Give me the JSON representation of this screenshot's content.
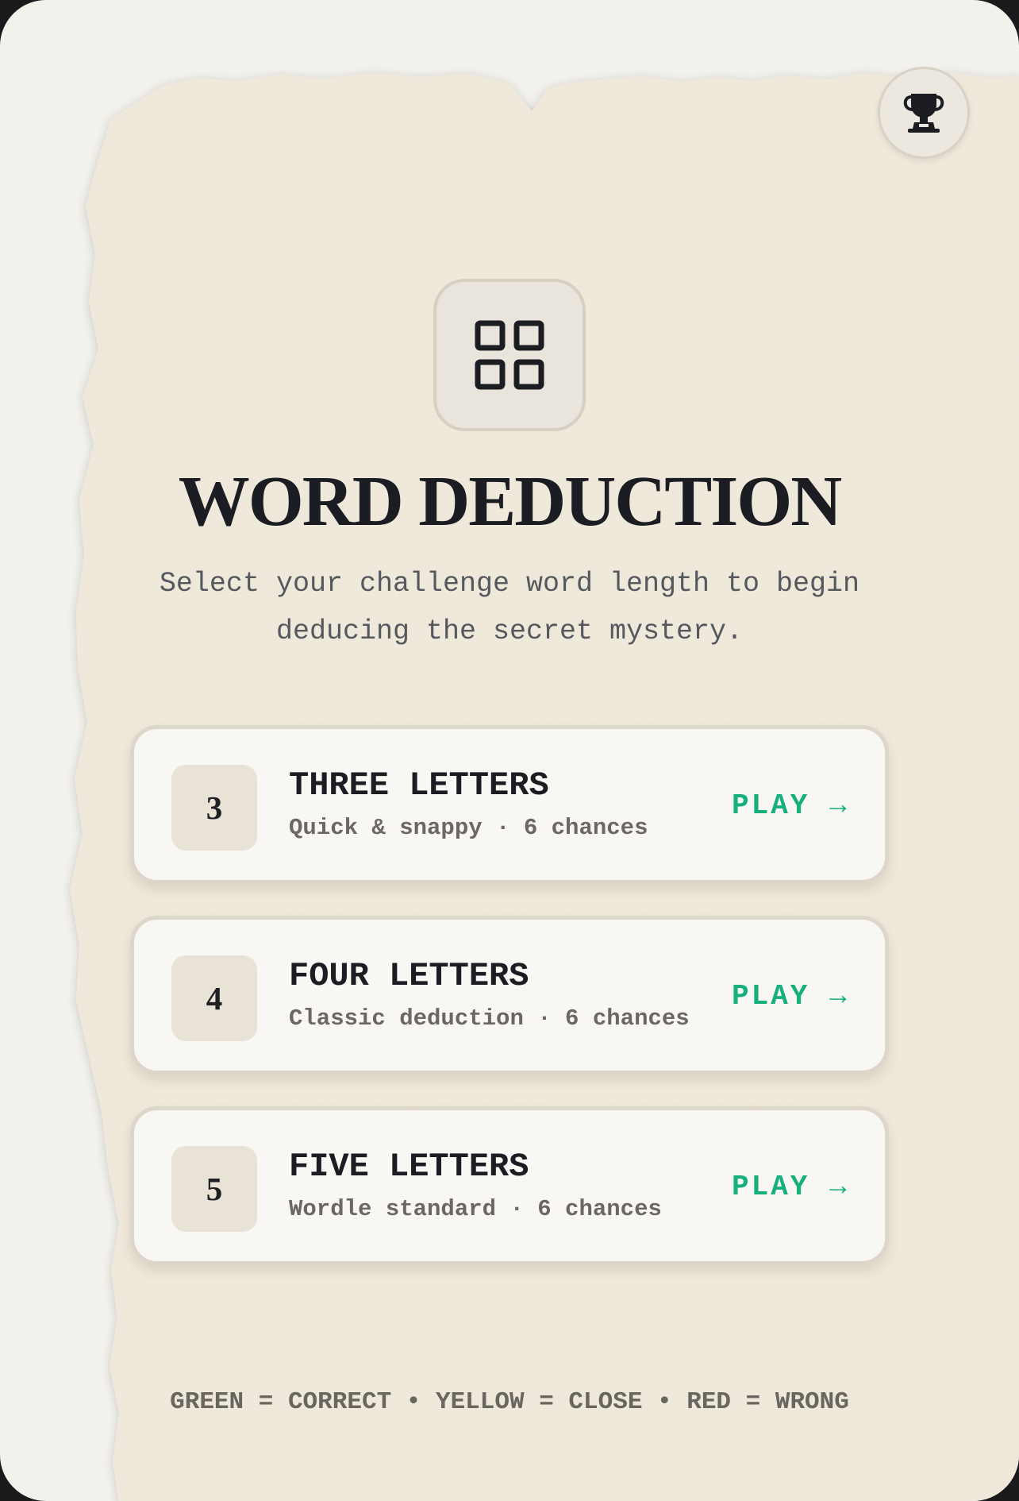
{
  "header": {
    "trophy_icon": "trophy-icon"
  },
  "hero": {
    "icon": "grid-icon",
    "title": "WORD DEDUCTION",
    "subtitle_line1": "Select your challenge word length to begin",
    "subtitle_line2": "deducing the secret mystery."
  },
  "levels": [
    {
      "number": "3",
      "name": "THREE LETTERS",
      "description": "Quick & snappy · 6 chances",
      "action": "PLAY →"
    },
    {
      "number": "4",
      "name": "FOUR LETTERS",
      "description": "Classic deduction · 6 chances",
      "action": "PLAY →"
    },
    {
      "number": "5",
      "name": "FIVE LETTERS",
      "description": "Wordle standard · 6 chances",
      "action": "PLAY →"
    }
  ],
  "legend": {
    "text": "GREEN = CORRECT • YELLOW = CLOSE • RED = WRONG"
  },
  "colors": {
    "accent_play": "#16b07c",
    "paper": "#f2ecdf",
    "ink": "#1b1d22"
  }
}
